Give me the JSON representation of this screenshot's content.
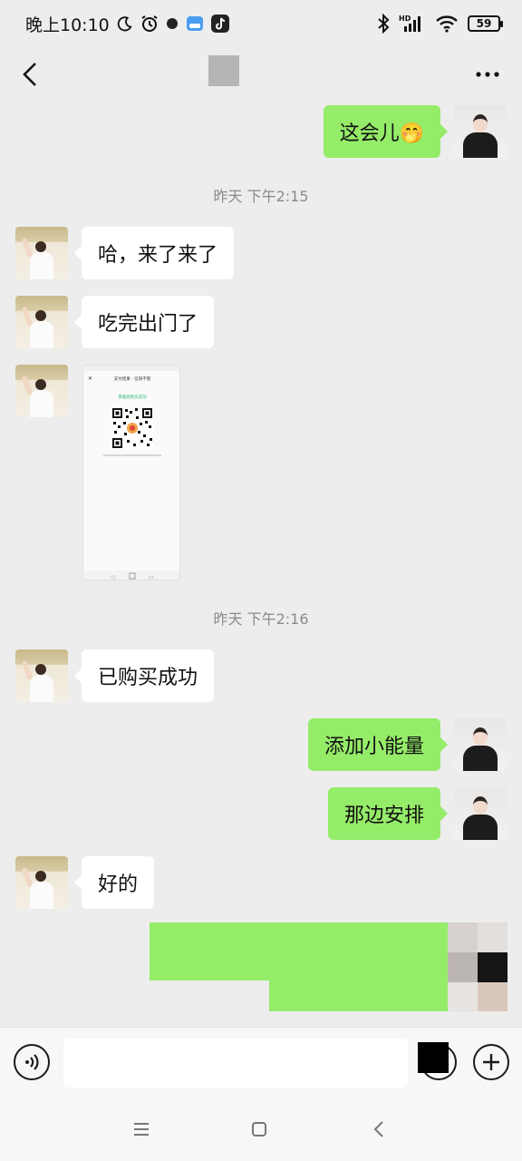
{
  "status_bar": {
    "time": "晚上10:10",
    "battery": "59",
    "network": "HD"
  },
  "messages": [
    {
      "side": "out",
      "text": "这会儿🤭"
    },
    {
      "type": "time",
      "text": "昨天 下午2:15"
    },
    {
      "side": "in",
      "text": "哈，来了来了"
    },
    {
      "side": "in",
      "text": "吃完出门了"
    },
    {
      "side": "in",
      "type": "image",
      "image": {
        "title": "支付结果 - 信阳不管",
        "status": "恭喜您购买成功"
      }
    },
    {
      "type": "time",
      "text": "昨天 下午2:16"
    },
    {
      "side": "in",
      "text": "已购买成功"
    },
    {
      "side": "out",
      "text": "添加小能量"
    },
    {
      "side": "out",
      "text": "那边安排"
    },
    {
      "side": "in",
      "text": "好的"
    }
  ],
  "input": {
    "value": ""
  }
}
